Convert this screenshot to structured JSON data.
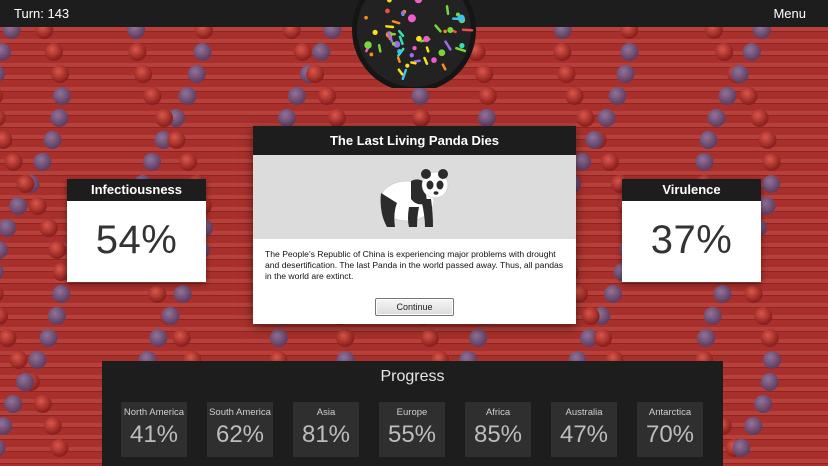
{
  "topbar": {
    "turn": "Turn: 143",
    "menu": "Menu"
  },
  "stats": {
    "infectiousness": {
      "label": "Infectiousness",
      "value": "54%"
    },
    "virulence": {
      "label": "Virulence",
      "value": "37%"
    }
  },
  "event": {
    "title": "The Last Living Panda Dies",
    "body": "The People's Republic of China is experiencing major problems with drought and desertification. The last Panda in the world passed away. Thus, all pandas in the world are extinct.",
    "button": "Continue"
  },
  "progress": {
    "title": "Progress",
    "regions": [
      {
        "name": "North America",
        "value": "41%"
      },
      {
        "name": "South America",
        "value": "62%"
      },
      {
        "name": "Asia",
        "value": "81%"
      },
      {
        "name": "Europe",
        "value": "55%"
      },
      {
        "name": "Africa",
        "value": "85%"
      },
      {
        "name": "Australia",
        "value": "47%"
      },
      {
        "name": "Antarctica",
        "value": "70%"
      }
    ]
  },
  "colors": {
    "background": "#a8302c",
    "panel": "#1d1d1d",
    "card": "#ffffff"
  }
}
